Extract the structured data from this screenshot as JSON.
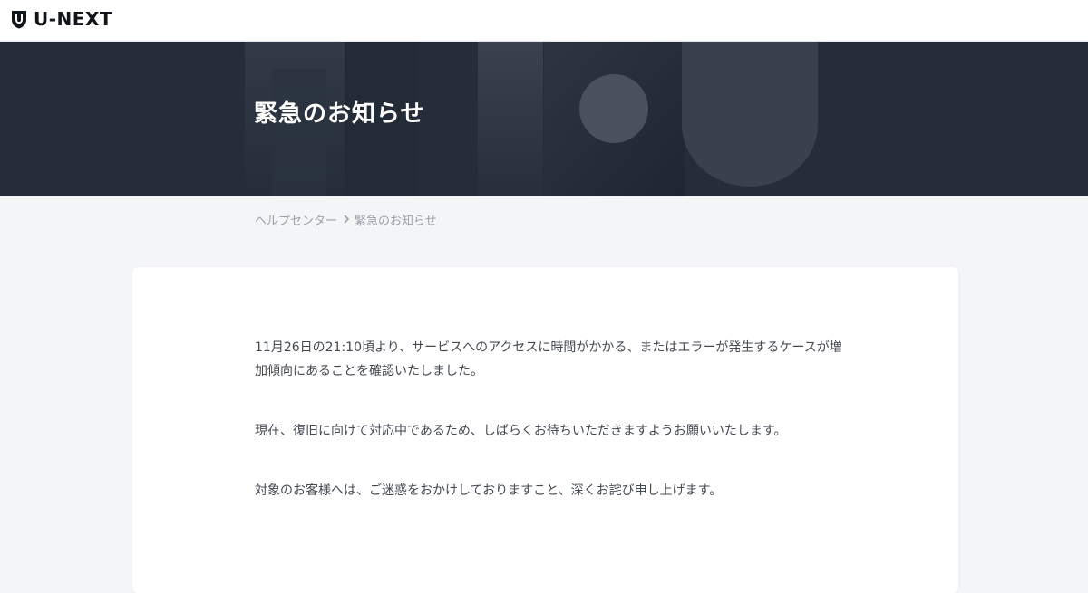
{
  "header": {
    "logo_text": "U-NEXT",
    "logo_icon": "shield-icon"
  },
  "hero": {
    "title": "緊急のお知らせ",
    "background_color": "#252d3a"
  },
  "breadcrumb": {
    "items": [
      {
        "label": "ヘルプセンター"
      },
      {
        "label": "緊急のお知らせ"
      }
    ],
    "separator_icon": "chevron-right-icon"
  },
  "notice": {
    "paragraphs": [
      "11月26日の21:10頃より、サービスへのアクセスに時間がかかる、またはエラーが発生するケースが増加傾向にあることを確認いたしました。",
      "現在、復旧に向けて対応中であるため、しばらくお待ちいただきますようお願いいたします。",
      "対象のお客様へは、ご迷惑をおかけしておりますこと、深くお詫び申し上げます。"
    ]
  }
}
